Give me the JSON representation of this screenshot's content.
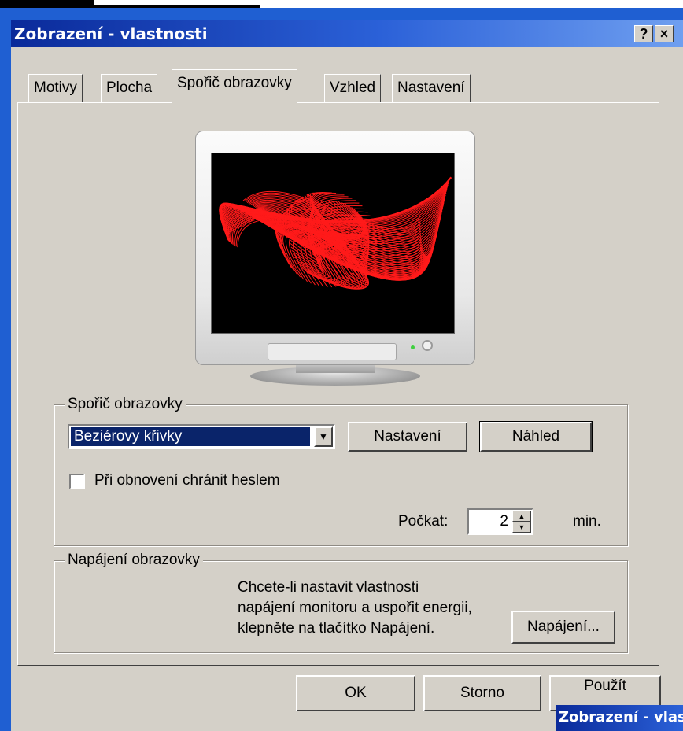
{
  "window": {
    "title": "Zobrazení - vlastnosti",
    "help_button": "?",
    "close_button": "×"
  },
  "tabs": [
    {
      "label": "Motivy"
    },
    {
      "label": "Plocha"
    },
    {
      "label": "Spořič obrazovky",
      "active": true
    },
    {
      "label": "Vzhled"
    },
    {
      "label": "Nastavení"
    }
  ],
  "screensaver": {
    "group_label": "Spořič obrazovky",
    "selected": "Beziérovy křivky",
    "settings_button": "Nastavení",
    "preview_button": "Náhled",
    "password_checkbox_label": "Při obnovení chránit heslem",
    "password_checked": false,
    "wait_label": "Počkat:",
    "wait_value": "2",
    "wait_unit": "min."
  },
  "power": {
    "group_label": "Napájení obrazovky",
    "description_line1": "Chcete-li nastavit vlastnosti",
    "description_line2": "napájení monitoru a uspořit energii,",
    "description_line3": "klepněte na tlačítko Napájení.",
    "power_button": "Napájení..."
  },
  "footer": {
    "ok": "OK",
    "cancel": "Storno",
    "apply": "Použít"
  },
  "second_window": {
    "title_fragment": "Zobrazení - vlast"
  },
  "colors": {
    "titlebar": "#0a2a9a",
    "selection": "#0a246a",
    "curves": "#ff1a1a",
    "face": "#d4d0c8"
  }
}
